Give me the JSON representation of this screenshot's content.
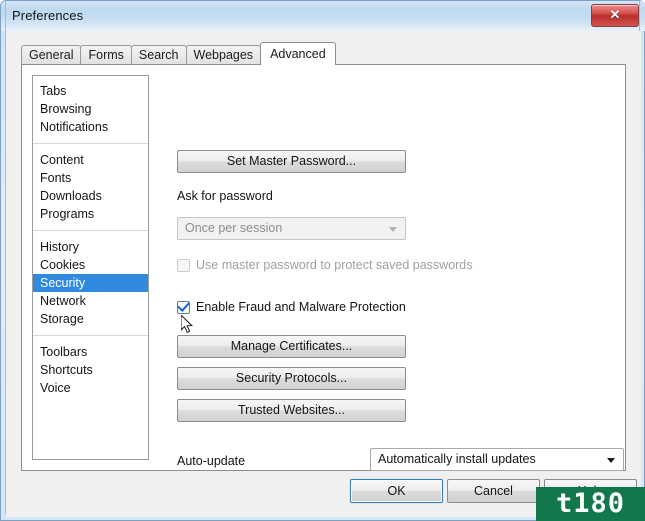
{
  "window": {
    "title": "Preferences",
    "close_glyph": "✕",
    "accent_selected": "#2f8ae0",
    "titlebar_color": "#c7def2",
    "close_button_color": "#bb2e2b"
  },
  "tabs": [
    {
      "label": "General",
      "active": false
    },
    {
      "label": "Forms",
      "active": false
    },
    {
      "label": "Search",
      "active": false
    },
    {
      "label": "Webpages",
      "active": false
    },
    {
      "label": "Advanced",
      "active": true
    }
  ],
  "sidebar": {
    "selected": "Security",
    "groups": [
      {
        "items": [
          "Tabs",
          "Browsing",
          "Notifications"
        ]
      },
      {
        "items": [
          "Content",
          "Fonts",
          "Downloads",
          "Programs"
        ]
      },
      {
        "items": [
          "History",
          "Cookies",
          "Security",
          "Network",
          "Storage"
        ]
      },
      {
        "items": [
          "Toolbars",
          "Shortcuts",
          "Voice"
        ]
      }
    ]
  },
  "main": {
    "set_master_password_button": "Set Master Password...",
    "ask_for_password_label": "Ask for password",
    "ask_for_password_value": "Once per session",
    "ask_for_password_disabled": true,
    "use_master_password_label": "Use master password to protect saved passwords",
    "use_master_password_checked": false,
    "use_master_password_disabled": true,
    "enable_fraud_label": "Enable Fraud and Malware Protection",
    "enable_fraud_checked": true,
    "manage_certificates_button": "Manage Certificates...",
    "security_protocols_button": "Security Protocols...",
    "trusted_websites_button": "Trusted Websites...",
    "auto_update_label": "Auto-update",
    "auto_update_value": "Automatically install updates"
  },
  "footer": {
    "ok_label": "OK",
    "cancel_label": "Cancel",
    "help_label": "Help"
  },
  "watermark": {
    "text": "t180",
    "background": "#12784b"
  }
}
